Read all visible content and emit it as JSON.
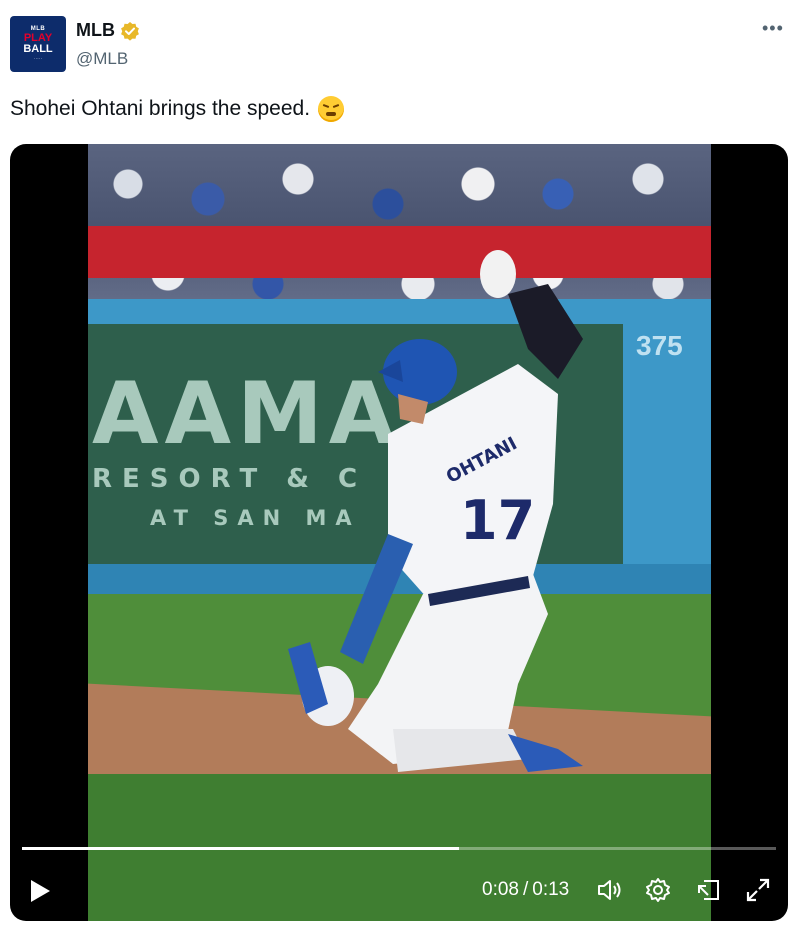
{
  "author": {
    "name": "MLB",
    "handle": "@MLB",
    "verified": true,
    "avatar_text": [
      "PLAY",
      "BALL"
    ]
  },
  "tweet": {
    "text": "Shohei Ohtani brings the speed.",
    "emoji": "face-with-steam-from-nose"
  },
  "video_scene": {
    "banner_line1": "AAMA",
    "banner_line2": "RESORT & C",
    "banner_line3": "AT SAN MA",
    "wall_distance": "375",
    "jersey_name": "OHTANI",
    "jersey_number": "17"
  },
  "video_player": {
    "current_time": "0:08",
    "separator": "/",
    "duration": "0:13",
    "progress_fraction": 0.58
  },
  "colors": {
    "verified_badge": "#E8B829",
    "handle_gray": "#536471",
    "video_bg": "#000000",
    "progress_fill": "#FFFFFF"
  },
  "icons": [
    "more-icon",
    "verified-icon",
    "play-icon",
    "volume-icon",
    "settings-icon",
    "pip-icon",
    "fullscreen-icon"
  ]
}
